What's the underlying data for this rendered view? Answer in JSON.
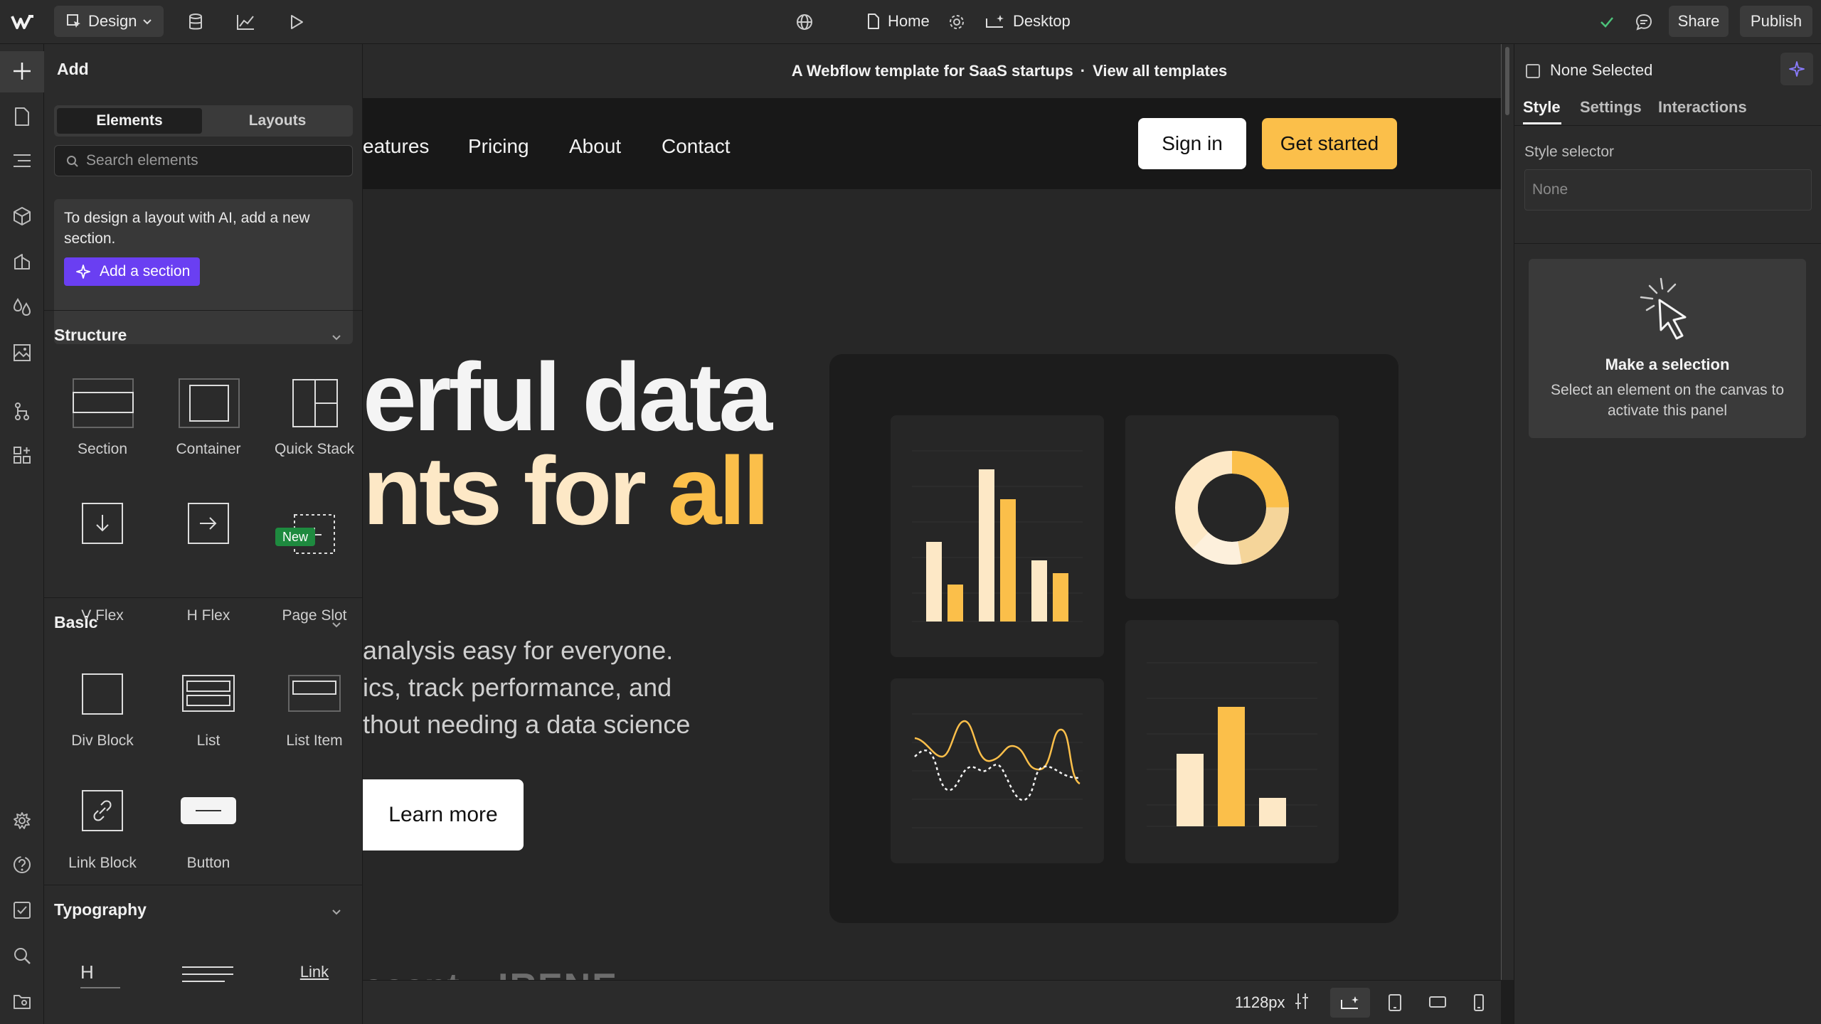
{
  "topbar": {
    "mode_label": "Design",
    "page_name": "Home",
    "breakpoint_label": "Desktop",
    "share_label": "Share",
    "publish_label": "Publish"
  },
  "add_panel": {
    "title": "Add",
    "tabs": [
      "Elements",
      "Layouts"
    ],
    "search_placeholder": "Search elements",
    "ai_text": "To design a layout with AI, add a new section.",
    "ai_button": "Add a section",
    "structure": {
      "heading": "Structure",
      "items": [
        "Section",
        "Container",
        "Quick Stack",
        "V Flex",
        "H Flex",
        "Page Slot"
      ],
      "new_badge": "New"
    },
    "basic": {
      "heading": "Basic",
      "items": [
        "Div Block",
        "List",
        "List Item",
        "Link Block",
        "Button"
      ]
    },
    "typography": {
      "heading": "Typography",
      "link_label": "Link",
      "heading_glyph": "H"
    }
  },
  "canvas": {
    "banner_text": "A Webflow template for SaaS startups",
    "banner_sep": "·",
    "banner_link": "View all templates",
    "nav_links": [
      "eatures",
      "Pricing",
      "About",
      "Contact"
    ],
    "sign_in": "Sign in",
    "get_started": "Get started",
    "hero_line1": "erful data",
    "hero_line2_a": "nts for ",
    "hero_line2_b": "all",
    "hero_p1": "analysis easy for everyone.",
    "hero_p2": "ics, track performance, and",
    "hero_p3": "thout needing a data science",
    "learn_more": "Learn more",
    "logo1": "ccent",
    "logo2": "IRENE",
    "colors": {
      "accent": "#fbbf4a",
      "cream": "#fde8c6"
    }
  },
  "right_panel": {
    "none_selected": "None Selected",
    "tabs": [
      "Style",
      "Settings",
      "Interactions"
    ],
    "style_selector_label": "Style selector",
    "style_selector_value": "None",
    "empty_title": "Make a selection",
    "empty_text": "Select an element on the canvas to activate this panel"
  },
  "bottombar": {
    "width_readout": "1128px"
  }
}
